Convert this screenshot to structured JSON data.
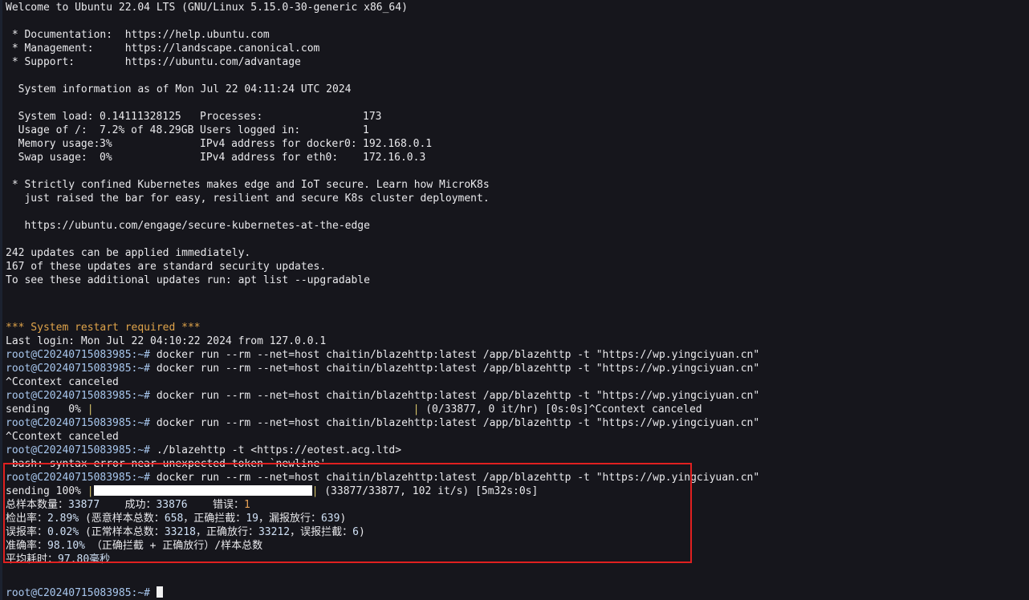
{
  "terminal": {
    "background_color": "#16161c",
    "foreground_color": "#e9e9ec",
    "highlight_box_color": "#e02020",
    "hostname_prompt": "root@C20240715083985:~#"
  },
  "motd": {
    "welcome": "Welcome to Ubuntu 22.04 LTS (GNU/Linux 5.15.0-30-generic x86_64)",
    "links": [
      {
        "label": " * Documentation:",
        "url": "https://help.ubuntu.com"
      },
      {
        "label": " * Management:",
        "url": "https://landscape.canonical.com"
      },
      {
        "label": " * Support:",
        "url": "https://ubuntu.com/advantage"
      }
    ],
    "sysinfo_header": "  System information as of Mon Jul 22 04:11:24 UTC 2024",
    "stats": [
      {
        "left_label": "  System load:",
        "left_value": "0.14111328125",
        "right_label": "Processes:",
        "right_value": "173"
      },
      {
        "left_label": "  Usage of /:",
        "left_value": "7.2% of 48.29GB",
        "right_label": "Users logged in:",
        "right_value": "1"
      },
      {
        "left_label": "  Memory usage:",
        "left_value": "3%",
        "right_label": "IPv4 address for docker0:",
        "right_value": "192.168.0.1"
      },
      {
        "left_label": "  Swap usage:",
        "left_value": "0%",
        "right_label": "IPv4 address for eth0:",
        "right_value": "172.16.0.3"
      }
    ],
    "promo_line1": " * Strictly confined Kubernetes makes edge and IoT secure. Learn how MicroK8s",
    "promo_line2": "   just raised the bar for easy, resilient and secure K8s cluster deployment.",
    "promo_url": "   https://ubuntu.com/engage/secure-kubernetes-at-the-edge",
    "updates_line1": "242 updates can be applied immediately.",
    "updates_line2": "167 of these updates are standard security updates.",
    "updates_line3": "To see these additional updates run: apt list --upgradable",
    "restart_required": "*** System restart required ***",
    "last_login": "Last login: Mon Jul 22 04:10:22 2024 from 127.0.0.1"
  },
  "session": {
    "docker_command": " docker run --rm --net=host chaitin/blazehttp:latest /app/blazehttp -t \"https://wp.yingciyuan.cn\"",
    "blazehttp_command": " ./blazehttp -t <https://eotest.acg.ltd>",
    "context_canceled": "^Ccontext canceled",
    "bash_error": "-bash: syntax error near unexpected token `newline'",
    "progress_zero": {
      "prefix": "sending   0% ",
      "suffix": " (0/33877, 0 it/hr) [0s:0s]^Ccontext canceled"
    },
    "progress_full": {
      "prefix": "sending 100% ",
      "suffix": " (33877/33877, 102 it/s) [5m32s:0s]"
    }
  },
  "results": {
    "summary": {
      "total_label": "总样本数量：",
      "total_value": "33877",
      "success_label": "成功：",
      "success_value": "33876",
      "error_label": "错误：",
      "error_value": "1"
    },
    "detection": {
      "label": "检出率：",
      "value": "2.89%",
      "detail": "(恶意样本总数：",
      "malicious_total": "658",
      "sep1": "，正确拦截：",
      "correct_block": "19",
      "sep2": "，漏报放行：",
      "missed_pass": "639",
      "close": ")"
    },
    "false_positive": {
      "label": "误报率：",
      "value": "0.02%",
      "detail": "(正常样本总数：",
      "normal_total": "33218",
      "sep1": "，正确放行：",
      "correct_pass": "33212",
      "sep2": "，误报拦截：",
      "fp_block": "6",
      "close": ")"
    },
    "accuracy": {
      "label": "准确率：",
      "value": "98.10%",
      "formula": "（正确拦截 + 正确放行）/样本总数"
    },
    "avg_time": {
      "label": "平均耗时：",
      "value": "97.80毫秒"
    }
  }
}
